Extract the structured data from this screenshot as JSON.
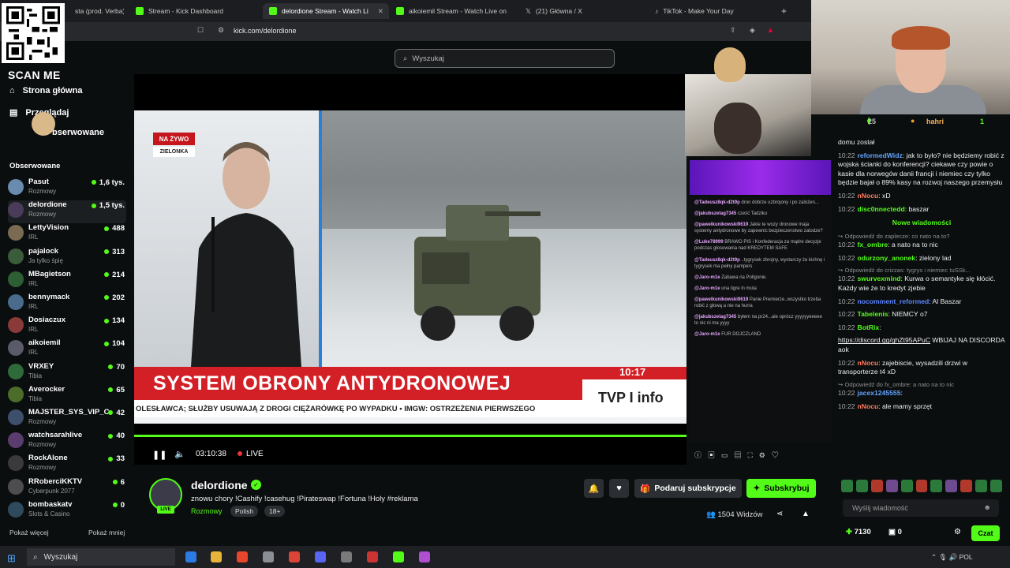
{
  "browser": {
    "tabs": [
      {
        "label": "sta (prod. Verba) (Lir"
      },
      {
        "label": "Stream - Kick Dashboard"
      },
      {
        "label": "delordione Stream - Watch Li"
      },
      {
        "label": "aikoiemil Stream - Watch Live on"
      },
      {
        "label": "(21) Główna / X"
      },
      {
        "label": "TikTok - Make Your Day"
      }
    ],
    "url": "kick.com/delordione",
    "new_tab": "+",
    "close": "✕"
  },
  "qr": {
    "caption": "SCAN ME"
  },
  "kick": {
    "search_placeholder": "Wyszukaj",
    "nav": {
      "home": "Strona główna",
      "browse": "Przeglądaj",
      "following_short": "bserwowane"
    },
    "following_header": "Obserwowane",
    "channels": [
      {
        "name": "Pasut",
        "sub": "Rozmowy",
        "viewers": "1,6 tys."
      },
      {
        "name": "delordione",
        "sub": "Rozmowy",
        "viewers": "1,5 tys."
      },
      {
        "name": "LettyVision",
        "sub": "IRL",
        "viewers": "488"
      },
      {
        "name": "pajalock",
        "sub": "Ja tylko śpię",
        "viewers": "313"
      },
      {
        "name": "MBagietson",
        "sub": "IRL",
        "viewers": "214"
      },
      {
        "name": "bennymack",
        "sub": "IRL",
        "viewers": "202"
      },
      {
        "name": "Dosiaczux",
        "sub": "IRL",
        "viewers": "134"
      },
      {
        "name": "aikoiemil",
        "sub": "IRL",
        "viewers": "104"
      },
      {
        "name": "VRXEY",
        "sub": "Tibia",
        "viewers": "70"
      },
      {
        "name": "Averocker",
        "sub": "Tibia",
        "viewers": "65"
      },
      {
        "name": "MAJSTER_SYS_VIP_C",
        "sub": "Rozmowy",
        "viewers": "42"
      },
      {
        "name": "watchsarahlive",
        "sub": "Rozmowy",
        "viewers": "40"
      },
      {
        "name": "RockAlone",
        "sub": "Rozmowy",
        "viewers": "33"
      },
      {
        "name": "RRoberciKKTV",
        "sub": "Cyberpunk 2077",
        "viewers": "6"
      },
      {
        "name": "bombaskatv",
        "sub": "Slots & Casino",
        "viewers": "0"
      }
    ],
    "show_more": "Pokaż więcej",
    "show_less": "Pokaż mniej"
  },
  "video": {
    "live_tag": "NA ŻYWO",
    "location": "ZIELONKA",
    "headline": "SYSTEM OBRONY ANTYDRONOWEJ",
    "ticker": "OLESŁAWCA; SŁUŻBY USUWAJĄ Z DROGI CIĘŻARÓWKĘ PO WYPADKU • IMGW: OSTRZEŻENIA PIERWSZEGO",
    "clock": "10:17",
    "channel_logo": "TVP I info",
    "time": "03:10:38",
    "live": "LIVE",
    "progress_fraction": 1.0
  },
  "overlay_chat": [
    {
      "user": "@Tadeusz8qk-d2t9p",
      "text": "dron dobrze uzbrojony i po zalożen..."
    },
    {
      "user": "@jakubszelag7345",
      "text": "cześć Tadziku"
    },
    {
      "user": "@pawelkunikowski9619",
      "text": "Jakie te wozy dronowe maja systemy antydronowe by zapewnic bezpieczenstwo zalodze?"
    },
    {
      "user": "@Luke78999",
      "text": "BRAWO PIS i Konfederacja za mądre decyzje podczas głosowania nad KREDYTEM SAFE"
    },
    {
      "user": "@Tadeusz8qk-d2t9p",
      "text": "..tygrysek zbrojny, wystarczy że kichnę i tygrysek ma pełny pampers"
    },
    {
      "user": "@Jaro-m1e",
      "text": "Zabawa na Poligonie."
    },
    {
      "user": "@Jaro-m1e",
      "text": "una tigre in muta"
    },
    {
      "user": "@pawelkunikowski9619",
      "text": "Panie Premierze..wszystko trzeba robić z głową a nie na hurra"
    },
    {
      "user": "@jakubszelag7345",
      "text": "byłem na pr24...ale oprócz yyyyyyeeeee to nic ni ma yyyy"
    },
    {
      "user": "@Jaro-m1e",
      "text": "FUR DOJCZLAND"
    }
  ],
  "streamer": {
    "name": "delordione",
    "live_badge": "LIVE",
    "title": "znowu chory !Cashify !casehug !Pirateswap !Fortuna !Holy #reklama",
    "category": "Rozmowy",
    "tags": [
      "Polish",
      "18+"
    ],
    "gift_sub": "Podaruj subskrypcje",
    "subscribe": "Subskrybuj",
    "viewers": "1504 Widzów"
  },
  "chat": {
    "top_count": "25",
    "top_user": "hahri",
    "top_right": "1",
    "messages": [
      {
        "kind": "plain",
        "text": "domu został"
      },
      {
        "kind": "msg",
        "time": "10:22",
        "user": "reformedWidz",
        "ucls": "u1",
        "text": ": jak to było? nie będziemy robić z wojska ścianki do konferencji? ciekawe czy powie o kasie dla norwegów danii francji i niemiec czy tylko będzie bajał o 89% kasy na rozwoj naszego przemysłu"
      },
      {
        "kind": "msg",
        "time": "10:22",
        "user": "nNocu",
        "ucls": "u3",
        "text": ": xD"
      },
      {
        "kind": "msg",
        "time": "10:22",
        "user": "disc0nnectedd",
        "ucls": "u2",
        "text": ": baszar"
      },
      {
        "kind": "new",
        "text": "Nowe wiadomości"
      },
      {
        "kind": "reply",
        "text": "Odpowiedź do zaplecze: co nato na to?"
      },
      {
        "kind": "msg",
        "time": "10:22",
        "user": "fx_ombre",
        "ucls": "u2",
        "text": ": a nato na to nic"
      },
      {
        "kind": "msg",
        "time": "10:22",
        "user": "odurzony_anonek",
        "ucls": "u2",
        "text": ": zielony lad"
      },
      {
        "kind": "reply",
        "text": "Odpowiedź do crizzas: tygrys i niemiec tuSSk..."
      },
      {
        "kind": "msg",
        "time": "10:22",
        "user": "swurvexmind",
        "ucls": "u2",
        "text": ": Kurwa o semantyke się kłócić. Każdy wie że to kredyt zjebie"
      },
      {
        "kind": "msg",
        "time": "10:22",
        "user": "nocomment_reformed",
        "ucls": "u4",
        "text": ": Al Baszar"
      },
      {
        "kind": "msg",
        "time": "10:22",
        "user": "Tabelenis",
        "ucls": "u2",
        "text": ": NIEMCY o7"
      },
      {
        "kind": "msg",
        "time": "10:22",
        "user": "BotRix",
        "ucls": "u2",
        "text": ":"
      },
      {
        "kind": "link",
        "text": "https://discord.gg/ghZt95APuC",
        "tail": " WBIJAJ NA DISCORDA aok"
      },
      {
        "kind": "msg",
        "time": "10:22",
        "user": "nNocu",
        "ucls": "u3",
        "text": ": zajebiscie, wysadzili drzwi w transporterze t4 xD"
      },
      {
        "kind": "reply",
        "text": "Odpowiedź do fx_ombre: a nato na to nic"
      },
      {
        "kind": "msg",
        "time": "10:22",
        "user": "jacex1245555",
        "ucls": "u1",
        "text": ":"
      },
      {
        "kind": "msg",
        "time": "10:22",
        "user": "nNocu",
        "ucls": "u3",
        "text": ": ale mamy sprzęt"
      }
    ],
    "input_placeholder": "Wyślij wiadomość",
    "points": "7130",
    "gifts": "0",
    "chat_button": "Czat"
  },
  "taskbar": {
    "search": "Wyszukaj",
    "tray": "POL"
  }
}
